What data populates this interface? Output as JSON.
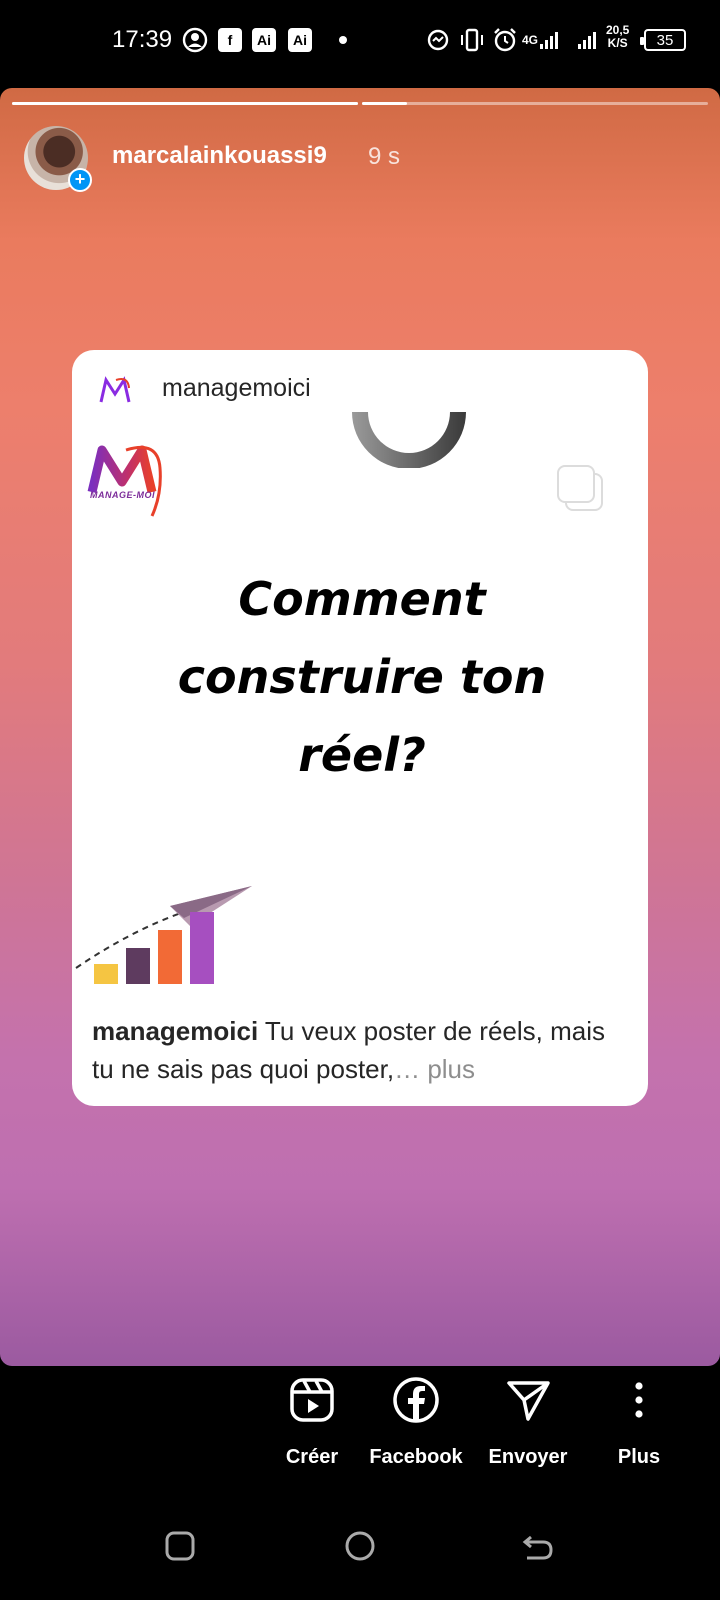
{
  "status_bar": {
    "time": "17:39",
    "icons": [
      "account-circle-icon",
      "facebook-icon",
      "ai-icon",
      "ai-icon",
      "dot-icon",
      "data-saver-icon",
      "vibrate-icon",
      "alarm-icon",
      "4g-signal-icon",
      "signal-icon"
    ],
    "ai_label": "Ai",
    "network": "4G",
    "speed_value": "20,5",
    "speed_unit": "K/S",
    "battery": "35"
  },
  "story": {
    "username": "marcalainkouassi9",
    "time_ago": "9 s",
    "progress": [
      1.0,
      0.13
    ]
  },
  "post": {
    "account": "managemoici",
    "brand_text": "MANAGE-MOI",
    "headline_lines": [
      "Comment",
      "construire ton",
      "réel?"
    ],
    "caption_user": "managemoici",
    "caption_text": " Tu veux poster de réels, mais tu ne sais pas quoi poster,",
    "caption_more": "… plus"
  },
  "actions": [
    {
      "name": "create",
      "label": "Créer",
      "icon": "reels-icon"
    },
    {
      "name": "facebook",
      "label": "Facebook",
      "icon": "facebook-icon"
    },
    {
      "name": "send",
      "label": "Envoyer",
      "icon": "send-icon"
    },
    {
      "name": "more",
      "label": "Plus",
      "icon": "more-vertical-icon"
    }
  ],
  "colors": {
    "story_top": "#d06a44",
    "story_bottom": "#9b5aa0",
    "accent_blue": "#0095f6"
  }
}
